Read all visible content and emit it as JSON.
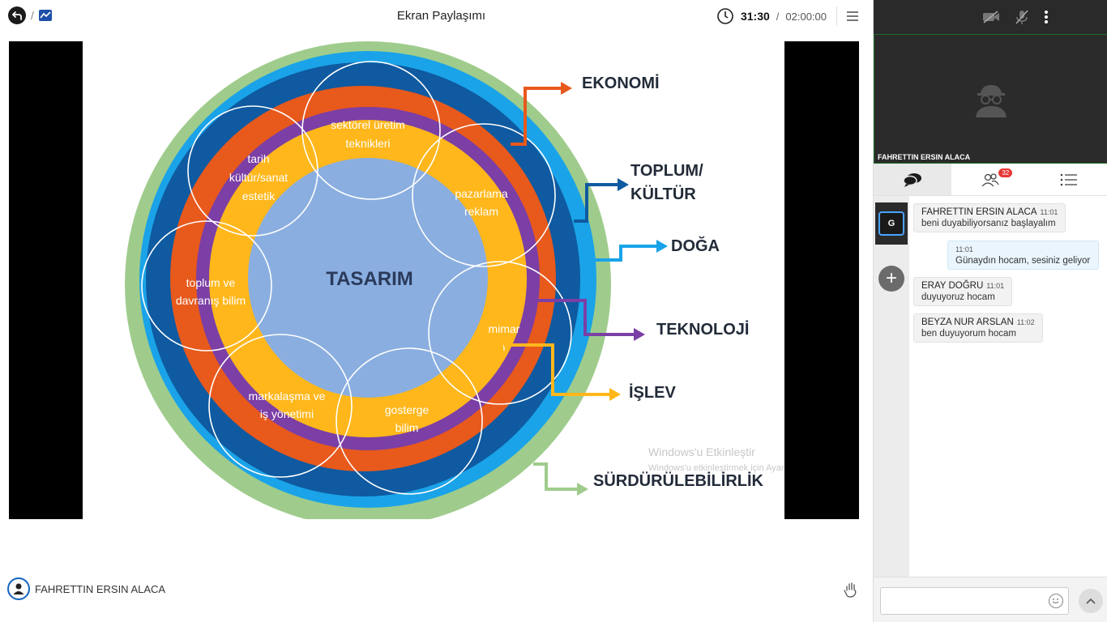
{
  "header": {
    "title": "Ekran Paylaşımı",
    "time_current": "31:30",
    "time_separator": "/",
    "time_total": "02:00:00"
  },
  "slide": {
    "center": "TASARIM",
    "circles": [
      [
        "sektörel üretim",
        "teknikleri"
      ],
      [
        "tarih",
        "kültür/sanat",
        "estetik"
      ],
      [
        "pazarlama",
        "reklam"
      ],
      [
        "toplum ve",
        "davranış bilim"
      ],
      [
        "mimar",
        "ı"
      ],
      [
        "markalaşma ve",
        "iş yönetimi"
      ],
      [
        "gosterge",
        "bilim"
      ]
    ],
    "labels": {
      "ekonomi": "EKONOMİ",
      "toplum_line1": "TOPLUM/",
      "toplum_line2": "KÜLTÜR",
      "doga": "DOĞA",
      "teknoloji": "TEKNOLOJİ",
      "islev": "İŞLEV",
      "surdurulebilirlik": "SÜRDÜRÜLEBİLİRLİK"
    },
    "watermark_line1": "Windows'u Etkinleştir",
    "watermark_line2": "Windows'u etkinleştirmek için Ayarlar'a gidin.",
    "colors": {
      "green": "#9fcc8c",
      "light_blue": "#1aa3e8",
      "dark_blue": "#0f5aa0",
      "orange": "#e8591c",
      "purple": "#7b3fa6",
      "yellow": "#ffb71b",
      "center": "#8aaee0"
    }
  },
  "presenter": {
    "name": "FAHRETTIN ERSIN ALACA"
  },
  "sidebar": {
    "camera_name": "FAHRETTIN ERSIN ALACA",
    "participant_count": "32",
    "avatar_letter": "G",
    "messages": [
      {
        "name": "FAHRETTIN ERSIN ALACA",
        "time": "11:01",
        "text": "beni duyabiliyorsanız başlayalım"
      },
      {
        "name": "",
        "time": "11:01",
        "text": "Günaydın hocam, sesiniz geliyor"
      },
      {
        "name": "ERAY DOĞRU",
        "time": "11:01",
        "text": "duyuyoruz hocam"
      },
      {
        "name": "BEYZA NUR ARSLAN",
        "time": "11:02",
        "text": "ben duyuyorum hocam"
      }
    ]
  }
}
